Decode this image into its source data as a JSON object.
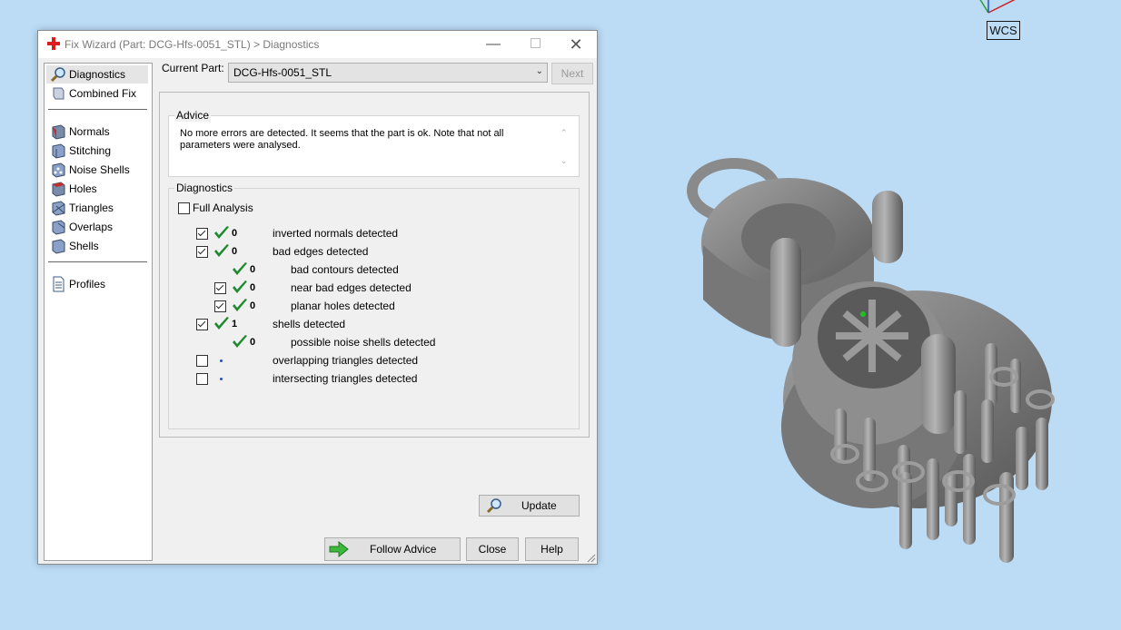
{
  "viewport": {
    "wcs_label": "WCS"
  },
  "dialog": {
    "title": "Fix Wizard (Part: DCG-Hfs-0051_STL) > Diagnostics",
    "sidebar": {
      "items": [
        {
          "label": "Diagnostics",
          "icon": "magnifier-icon",
          "selected": true
        },
        {
          "label": "Combined Fix",
          "icon": "combined-fix-icon"
        },
        {
          "label": "Normals",
          "icon": "normals-icon"
        },
        {
          "label": "Stitching",
          "icon": "stitching-icon"
        },
        {
          "label": "Noise Shells",
          "icon": "noise-shells-icon"
        },
        {
          "label": "Holes",
          "icon": "holes-icon"
        },
        {
          "label": "Triangles",
          "icon": "triangles-icon"
        },
        {
          "label": "Overlaps",
          "icon": "overlaps-icon"
        },
        {
          "label": "Shells",
          "icon": "shells-icon"
        },
        {
          "label": "Profiles",
          "icon": "profiles-icon"
        }
      ]
    },
    "current_part_label": "Current Part:",
    "current_part_value": "DCG-Hfs-0051_STL",
    "next_label": "Next",
    "advice": {
      "title": "Advice",
      "text": "No more errors are detected. It seems that the part is ok. Note that not all parameters were analysed."
    },
    "diagnostics": {
      "title": "Diagnostics",
      "full_analysis_label": "Full Analysis",
      "rows": [
        {
          "checkbox": true,
          "checked": true,
          "status": "ok",
          "count": "0",
          "text": "inverted normals detected",
          "indent": 0
        },
        {
          "checkbox": true,
          "checked": true,
          "status": "ok",
          "count": "0",
          "text": "bad edges detected",
          "indent": 0
        },
        {
          "checkbox": false,
          "checked": false,
          "status": "ok",
          "count": "0",
          "text": "bad contours detected",
          "indent": 1
        },
        {
          "checkbox": true,
          "checked": true,
          "status": "ok",
          "count": "0",
          "text": "near bad edges detected",
          "indent": 1
        },
        {
          "checkbox": true,
          "checked": true,
          "status": "ok",
          "count": "0",
          "text": "planar holes detected",
          "indent": 1
        },
        {
          "checkbox": true,
          "checked": true,
          "status": "ok",
          "count": "1",
          "text": "shells detected",
          "indent": 0
        },
        {
          "checkbox": false,
          "checked": false,
          "status": "ok",
          "count": "0",
          "text": "possible noise shells detected",
          "indent": 1
        },
        {
          "checkbox": true,
          "checked": false,
          "status": "pending",
          "count": "",
          "text": "overlapping triangles detected",
          "indent": 0
        },
        {
          "checkbox": true,
          "checked": false,
          "status": "pending",
          "count": "",
          "text": "intersecting triangles detected",
          "indent": 0
        }
      ],
      "update_label": "Update"
    },
    "buttons": {
      "follow_advice": "Follow Advice",
      "close": "Close",
      "help": "Help"
    },
    "colors": {
      "check_green": "#1e8a2e",
      "accent_red": "#d92020"
    }
  }
}
